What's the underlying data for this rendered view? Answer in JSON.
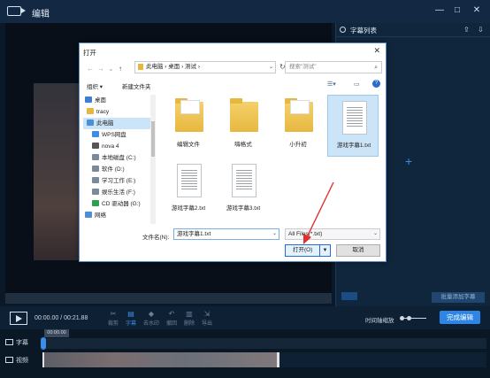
{
  "app": {
    "title": "编辑",
    "minimize": "—",
    "maximize": "□",
    "close": "✕"
  },
  "subtitle_panel": {
    "title": "字幕列表",
    "batch_add_label": "批量添加字幕"
  },
  "controls": {
    "timecode": "00:00.00 / 00:21.88",
    "tools": [
      {
        "icon": "scissors-icon",
        "label": "裁剪",
        "active": false
      },
      {
        "icon": "subtitle-icon",
        "label": "字幕",
        "active": true
      },
      {
        "icon": "eraser-icon",
        "label": "去水印",
        "active": false
      },
      {
        "icon": "undo-icon",
        "label": "撤回",
        "active": false
      },
      {
        "icon": "delete-icon",
        "label": "删除",
        "active": false
      },
      {
        "icon": "export-icon",
        "label": "导出",
        "active": false
      }
    ],
    "zoom_label": "时间轴缩放",
    "zoom_level": 0.1,
    "finish_label": "完成编辑"
  },
  "timeline": {
    "playhead_time": "00:00.00",
    "tracks": [
      {
        "label": "字幕"
      },
      {
        "label": "视频"
      }
    ]
  },
  "dialog": {
    "title": "打开",
    "close": "✕",
    "breadcrumb": "此电脑 › 桌面 › 测试 ›",
    "search_placeholder": "搜索\"测试\"",
    "organize_label": "组织 ▾",
    "new_folder_label": "新建文件夹",
    "nav_items": [
      {
        "label": "桌面",
        "color": "#3a7fd5",
        "selected": false
      },
      {
        "label": "tracy",
        "color": "#e6b840",
        "selected": false
      },
      {
        "label": "此电脑",
        "color": "#4a8fd8",
        "selected": true
      },
      {
        "label": "WPS网盘",
        "color": "#3a8ee6",
        "selected": false
      },
      {
        "label": "nova 4",
        "color": "#555555",
        "selected": false
      },
      {
        "label": "本地磁盘 (C:)",
        "color": "#7a8a9a",
        "selected": false
      },
      {
        "label": "软件 (D:)",
        "color": "#7a8a9a",
        "selected": false
      },
      {
        "label": "学习工作 (E:)",
        "color": "#7a8a9a",
        "selected": false
      },
      {
        "label": "娱乐生活 (F:)",
        "color": "#7a8a9a",
        "selected": false
      },
      {
        "label": "CD 驱动器 (G:)",
        "color": "#2e9e4f",
        "selected": false
      },
      {
        "label": "网络",
        "color": "#4a8fd8",
        "selected": false
      }
    ],
    "files": [
      {
        "name": "编辑文件",
        "type": "folder-docs",
        "selected": false
      },
      {
        "name": "嗨格式",
        "type": "folder",
        "selected": false
      },
      {
        "name": "小升初",
        "type": "folder-docs",
        "selected": false
      },
      {
        "name": "游戏字幕1.txt",
        "type": "doc",
        "selected": true
      },
      {
        "name": "游戏字幕2.txt",
        "type": "doc",
        "selected": false
      },
      {
        "name": "游戏字幕3.txt",
        "type": "doc",
        "selected": false
      }
    ],
    "filename_label": "文件名(N):",
    "filename_value": "游戏字幕1.txt",
    "filetype_value": "All Files(*.txt)",
    "open_label": "打开(O)",
    "cancel_label": "取消"
  },
  "colors": {
    "accent": "#2d86e5",
    "arrow": "#e0312f"
  }
}
